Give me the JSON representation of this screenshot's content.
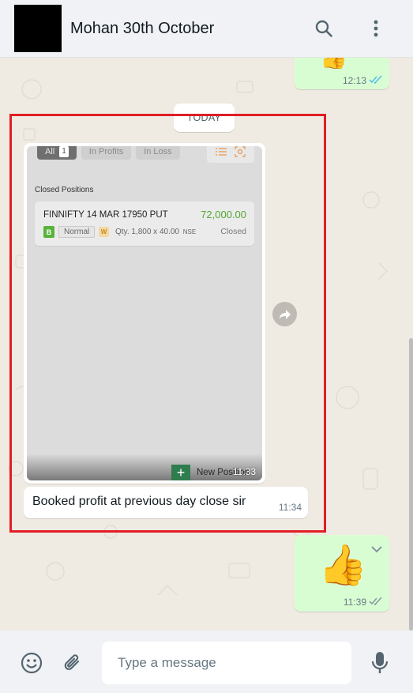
{
  "header": {
    "contact_name": "Mohan 30th October",
    "icons": [
      "search-icon",
      "more-vertical-icon"
    ]
  },
  "messages": {
    "prev_outgoing": {
      "emoji": "👍",
      "time": "12:13",
      "status": "read"
    },
    "date_divider": "TODAY",
    "image_message": {
      "time": "11:33",
      "screenshot": {
        "filters": [
          {
            "label": "All",
            "count": "1"
          },
          {
            "label": "In Profits"
          },
          {
            "label": "In Loss"
          }
        ],
        "section_title": "Closed Positions",
        "position": {
          "symbol": "FINNIFTY 14 MAR 17950 PUT",
          "pnl": "72,000.00",
          "type_badge": "B",
          "order_type": "Normal",
          "expiry_badge": "W",
          "qty": "Qty. 1,800 x 40.00",
          "exchange": "NSE",
          "status": "Closed"
        },
        "new_position_label": "New Position"
      }
    },
    "text_message": {
      "text": "Booked profit at previous day close sir",
      "time": "11:34"
    },
    "last_outgoing": {
      "emoji": "👍",
      "time": "11:39",
      "status": "delivered"
    }
  },
  "composer": {
    "placeholder": "Type a message",
    "icons": [
      "emoji-icon",
      "attach-icon",
      "mic-icon"
    ]
  },
  "colors": {
    "outgoing_bubble": "#d9fdd3",
    "highlight_border": "#e01e26",
    "profit_green": "#53a632",
    "read_tick": "#53bdeb"
  }
}
